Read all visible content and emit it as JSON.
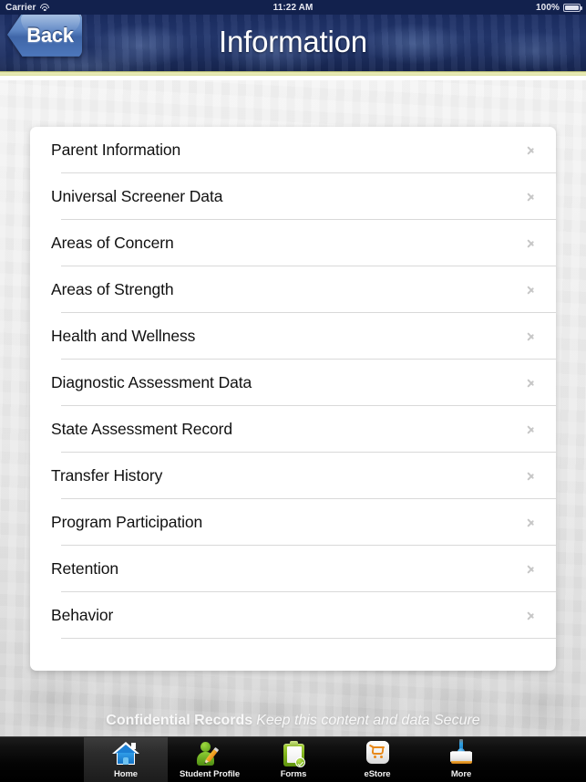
{
  "statusbar": {
    "carrier": "Carrier",
    "wifi_icon": "wifi-icon",
    "time": "11:22 AM",
    "battery_percent": "100%",
    "battery_icon": "battery-full-icon"
  },
  "header": {
    "title": "Information",
    "back_label": "Back",
    "background_color": "#1d2f62",
    "accent_color": "#e2e5ad"
  },
  "list": {
    "items": [
      {
        "label": "Parent Information",
        "chevron": "chevron-right-icon"
      },
      {
        "label": "Universal Screener Data",
        "chevron": "chevron-right-icon"
      },
      {
        "label": "Areas of Concern",
        "chevron": "chevron-right-icon"
      },
      {
        "label": "Areas of Strength",
        "chevron": "chevron-right-icon"
      },
      {
        "label": "Health and Wellness",
        "chevron": "chevron-right-icon"
      },
      {
        "label": "Diagnostic Assessment Data",
        "chevron": "chevron-right-icon"
      },
      {
        "label": "State Assessment Record",
        "chevron": "chevron-right-icon"
      },
      {
        "label": "Transfer History",
        "chevron": "chevron-right-icon"
      },
      {
        "label": "Program Participation",
        "chevron": "chevron-right-icon"
      },
      {
        "label": "Retention",
        "chevron": "chevron-right-icon"
      },
      {
        "label": "Behavior",
        "chevron": "chevron-right-icon"
      }
    ]
  },
  "watermark": {
    "bold_text": "Confidential Records",
    "italic_text": "Keep this content and data Secure"
  },
  "tabbar": {
    "items": [
      {
        "label": "Home",
        "icon": "home-icon",
        "selected": true
      },
      {
        "label": "Student Profile",
        "icon": "student-profile-icon",
        "selected": false
      },
      {
        "label": "Forms",
        "icon": "forms-clipboard-icon",
        "selected": false
      },
      {
        "label": "eStore",
        "icon": "estore-cart-icon",
        "selected": false
      },
      {
        "label": "More",
        "icon": "more-box-icon",
        "selected": false
      }
    ]
  }
}
